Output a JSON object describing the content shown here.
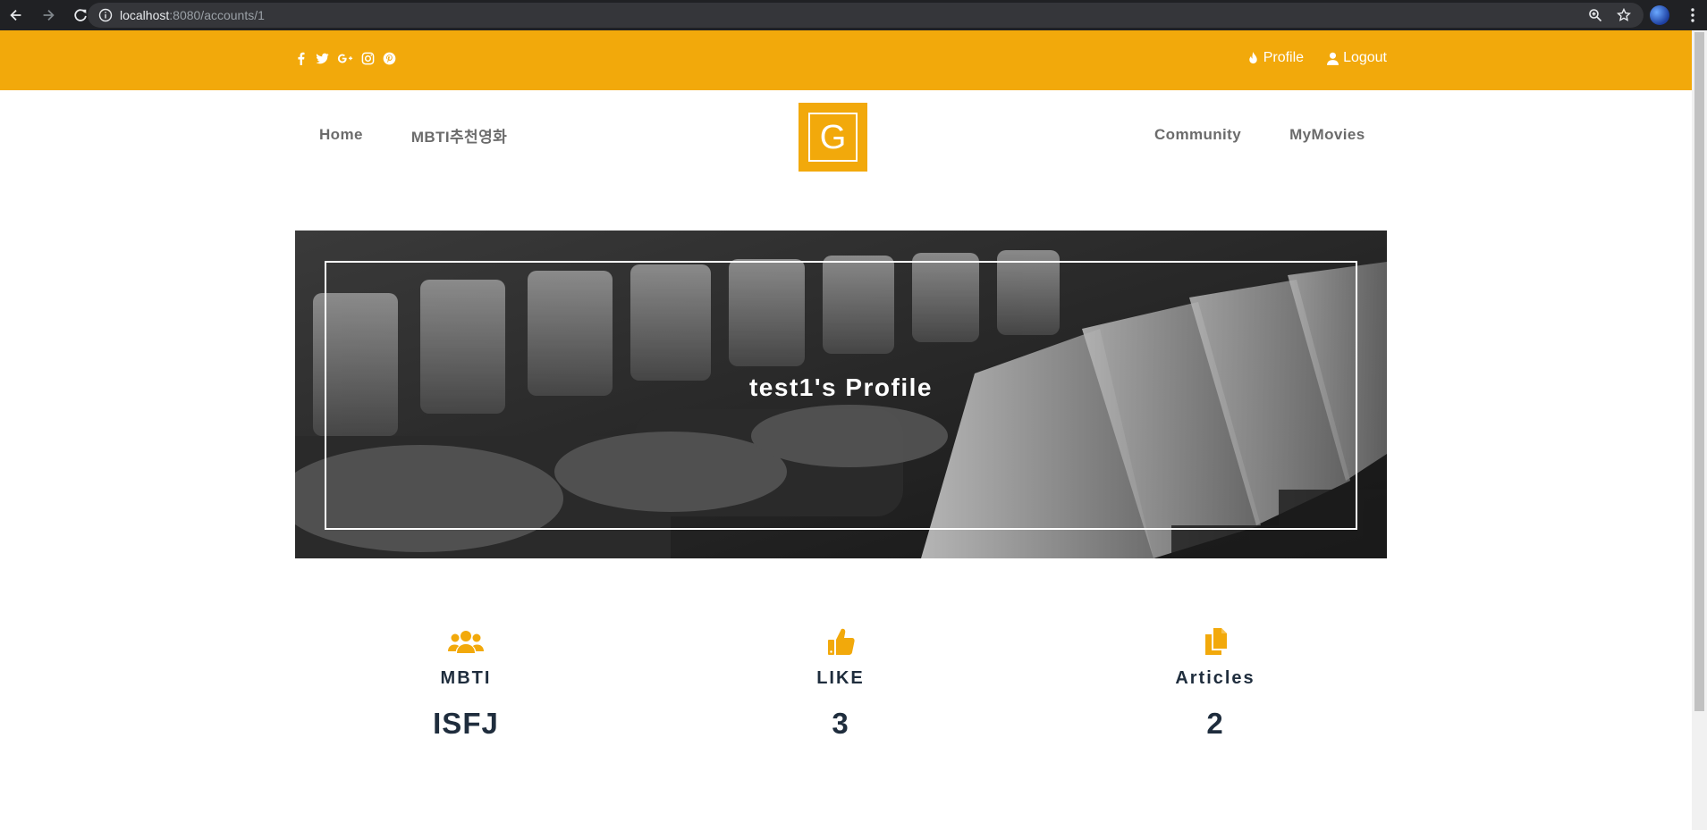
{
  "browser": {
    "url_host": "localhost",
    "url_path": ":8080/accounts/1"
  },
  "topbar": {
    "social_icons": [
      "facebook-icon",
      "twitter-icon",
      "google-plus-icon",
      "instagram-icon",
      "pinterest-icon"
    ],
    "profile_label": "Profile",
    "logout_label": "Logout"
  },
  "nav": {
    "left": [
      "Home",
      "MBTI추천영화"
    ],
    "right": [
      "Community",
      "MyMovies"
    ],
    "logo_letter": "G"
  },
  "hero": {
    "title": "test1's Profile"
  },
  "stats": [
    {
      "icon": "users-icon",
      "label": "MBTI",
      "value": "ISFJ"
    },
    {
      "icon": "thumbs-up-icon",
      "label": "LIKE",
      "value": "3"
    },
    {
      "icon": "documents-icon",
      "label": "Articles",
      "value": "2"
    }
  ],
  "colors": {
    "accent": "#f2a90b",
    "text_dark": "#1f2d3d",
    "nav_text": "#6b6b6b",
    "chrome_bg": "#202124"
  }
}
